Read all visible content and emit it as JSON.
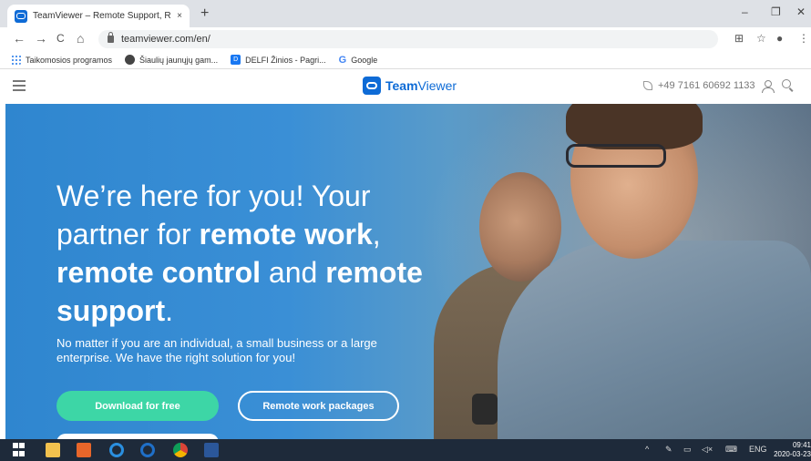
{
  "browser": {
    "tab_title": "TeamViewer – Remote Support, R",
    "tab_close": "×",
    "new_tab": "+",
    "url": "teamviewer.com/en/",
    "window_controls": {
      "minimize": "–",
      "restore": "❐",
      "close": "✕"
    },
    "nav": {
      "back": "←",
      "forward": "→",
      "reload": "C",
      "home": "⌂"
    },
    "toolbar_icons": {
      "translate": "⊞",
      "star": "☆",
      "profile": "●",
      "menu": "⋮"
    }
  },
  "bookmarks": [
    {
      "label": "Taikomosios programos",
      "icon": "apps-grid-icon"
    },
    {
      "label": "Šiaulių jaunųjų gam...",
      "icon": "globe-icon"
    },
    {
      "label": "DELFI Žinios - Pagri...",
      "icon": "delfi-icon",
      "glyph": "D"
    },
    {
      "label": "Google",
      "icon": "google-icon",
      "glyph": "G"
    }
  ],
  "site": {
    "logo_bold": "Team",
    "logo_light": "Viewer",
    "phone": "+49 7161 60692 1133"
  },
  "hero": {
    "title_1": "We’re here for you! Your partner for ",
    "title_b1": "remote work",
    "title_2": ", ",
    "title_b2": "remote control",
    "title_3": " and ",
    "title_b3": "remote support",
    "title_4": ".",
    "subtitle": "No matter if you are an individual, a small business or a large enterprise. We have the right solution for you!",
    "primary_button": "Download for free",
    "secondary_button": "Remote work packages"
  },
  "taskbar": {
    "lang": "ENG",
    "time": "09:41",
    "date": "2020-03-23",
    "tray_chevron": "^",
    "colors": {
      "bg": "#1e2a3a"
    }
  },
  "colors": {
    "brand": "#0e6bd6",
    "cta": "#3dd6a6",
    "hero": "#2f86cf"
  }
}
